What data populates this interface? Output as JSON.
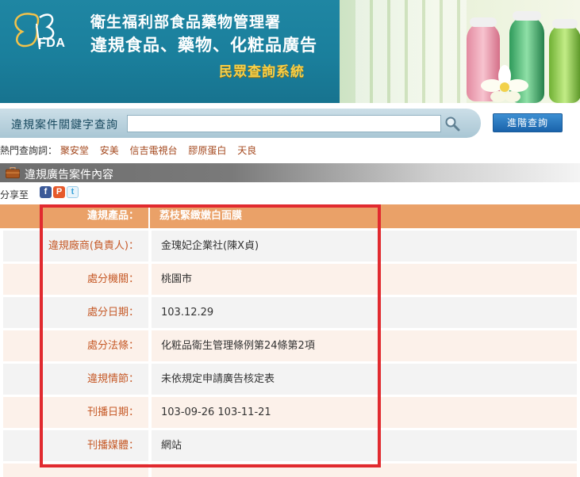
{
  "banner": {
    "logo_text": "FDA",
    "line1": "衛生福利部食品藥物管理署",
    "line2": "違規食品、藥物、化粧品廣告",
    "line3": "民眾查詢系統"
  },
  "search": {
    "label": "違規案件關鍵字查詢",
    "value": "",
    "placeholder": "",
    "advanced_label": "進階查詢"
  },
  "hot_keywords": {
    "label": "熱門查詢詞：",
    "items": [
      "聚安堂",
      "安美",
      "信吉電視台",
      "膠原蛋白",
      "天良"
    ]
  },
  "section": {
    "title": "違規廣告案件內容"
  },
  "share": {
    "label": "分享至",
    "icons": [
      "facebook-icon",
      "plurk-icon",
      "twitter-icon"
    ]
  },
  "detail": {
    "header": {
      "label": "違規產品：",
      "value": "荔枝緊緻嫩白面膜"
    },
    "rows": [
      {
        "label": "違規廠商(負責人)：",
        "value": "金瑰妃企業社(陳X貞)"
      },
      {
        "label": "處分機關：",
        "value": "桃園市"
      },
      {
        "label": "處分日期：",
        "value": "103.12.29"
      },
      {
        "label": "處分法條：",
        "value": "化粧品衛生管理條例第24條第2項"
      },
      {
        "label": "違規情節：",
        "value": "未依規定申請廣告核定表"
      },
      {
        "label": "刊播日期：",
        "value": "103-09-26 103-11-21"
      },
      {
        "label": "刊播媒體：",
        "value": "網站"
      }
    ]
  },
  "colors": {
    "banner": "#1a7f9c",
    "header_row": "#eaa168",
    "label_text": "#c65a28",
    "highlight_box": "#e12a2f",
    "gold_text": "#f6d04a"
  }
}
